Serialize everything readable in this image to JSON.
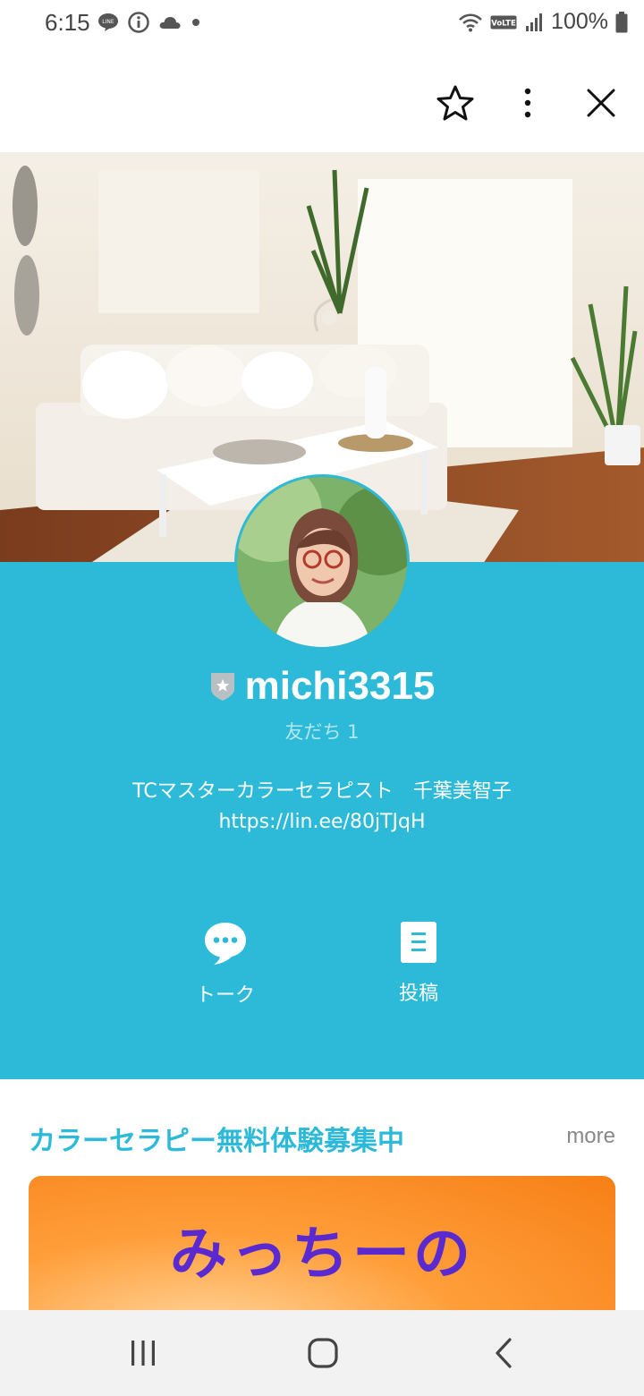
{
  "status_bar": {
    "time": "6:15",
    "battery": "100%",
    "icons": [
      "line-icon",
      "info-icon",
      "cloud-icon",
      "dot-icon",
      "wifi-icon",
      "volte-icon",
      "signal-icon",
      "battery-icon"
    ]
  },
  "top_bar": {
    "icons": [
      "star-icon",
      "more-vert-icon",
      "close-icon"
    ]
  },
  "profile": {
    "name": "michi3315",
    "friends": "友だち 1",
    "description_line1": "TCマスターカラーセラピスト　千葉美智子",
    "description_line2": "https://lin.ee/80jTJqH",
    "badge_icon": "shield-star-icon"
  },
  "actions": [
    {
      "label": "トーク",
      "icon": "chat-bubble-icon"
    },
    {
      "label": "投稿",
      "icon": "post-icon"
    }
  ],
  "section": {
    "title": "カラーセラピー無料体験募集中",
    "more": "more",
    "banner_text": "みっちーの"
  },
  "nav_bar": {
    "icons": [
      "recent-apps-icon",
      "home-icon",
      "back-icon"
    ]
  },
  "colors": {
    "accent": "#2cbad8",
    "banner_text": "#5a2ad0"
  }
}
